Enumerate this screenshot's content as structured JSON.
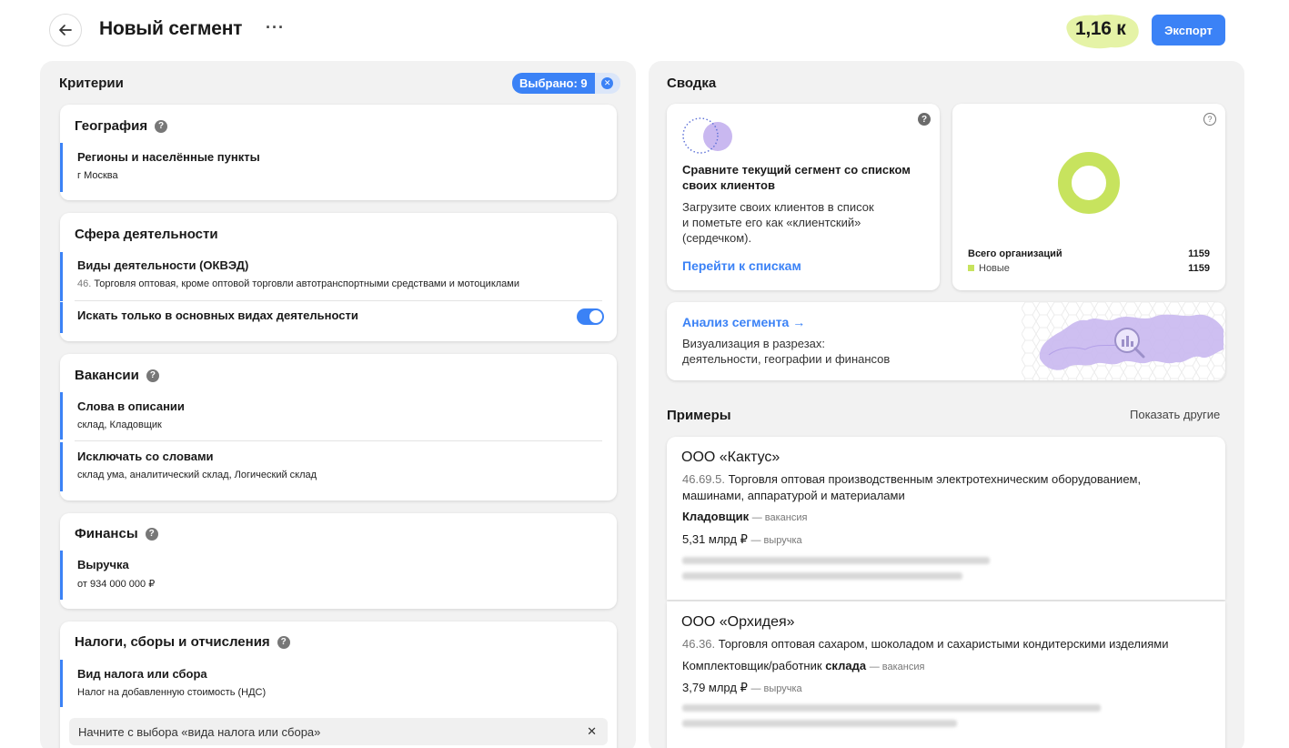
{
  "header": {
    "title": "Новый сегмент",
    "more": "···",
    "count": "1,16 к",
    "export_label": "Экспорт"
  },
  "criteria": {
    "title": "Критерии",
    "selected": "Выбрано: 9",
    "geography": {
      "title": "География",
      "regions_label": "Регионы и населённые пункты",
      "regions_value": "г Москва"
    },
    "activity": {
      "title": "Сфера деятельности",
      "okved_label": "Виды деятельности (ОКВЭД)",
      "okved_code": "46.",
      "okved_value": "Торговля оптовая, кроме оптовой торговли автотранспортными средствами и мотоциклами",
      "main_only_label": "Искать только в основных видах деятельности",
      "main_only_on": true
    },
    "vacancies": {
      "title": "Вакансии",
      "words_label": "Слова в описании",
      "words_value": "склад, Кладовщик",
      "exclude_label": "Исключать со словами",
      "exclude_value": "склад ума, аналитический склад, Логический склад"
    },
    "finance": {
      "title": "Финансы",
      "revenue_label": "Выручка",
      "revenue_value": "от 934 000 000 ₽"
    },
    "taxes": {
      "title": "Налоги, сборы и отчисления",
      "tax_label": "Вид налога или сбора",
      "tax_value": "Налог на добавленную стоимость (НДС)",
      "input_placeholder": "Начните с выбора «вида налога или сбора»"
    }
  },
  "summary": {
    "title": "Сводка",
    "compare": {
      "title": "Сравните текущий сегмент со списком своих клиентов",
      "description_lines": [
        "Загрузите своих клиентов в список",
        "и пометьте его как «клиентский»",
        "(сердечком)."
      ],
      "link": "Перейти к спискам"
    },
    "stats": {
      "total_label": "Всего организаций",
      "total_value": "1159",
      "new_label": "Новые",
      "new_value": "1159",
      "new_color": "#c7e35e"
    },
    "analysis": {
      "link": "Анализ сегмента →",
      "description_lines": [
        "Визуализация в разрезах:",
        "деятельности, географии и финансов"
      ]
    }
  },
  "examples": {
    "title": "Примеры",
    "show_more": "Показать другие",
    "items": [
      {
        "name": "ООО «Кактус»",
        "code": "46.69.5.",
        "activity": "Торговля оптовая производственным электротехническим оборудованием, машинами, аппаратурой и материалами",
        "vacancy_pre": "",
        "vacancy_bold": "Кладовщик",
        "vacancy_tag": "— вакансия",
        "revenue": "5,31 млрд ₽",
        "revenue_tag": "— выручка"
      },
      {
        "name": "ООО «Орхидея»",
        "code": "46.36.",
        "activity": "Торговля оптовая сахаром, шоколадом и сахаристыми кондитерскими изделиями",
        "vacancy_pre": "Комплектовщик/работник ",
        "vacancy_bold": "склада",
        "vacancy_tag": "— вакансия",
        "revenue": "3,79 млрд ₽",
        "revenue_tag": "— выручка"
      }
    ]
  },
  "colors": {
    "accent": "#3b82f6",
    "lime": "#c7e35e",
    "purple": "#c9b8f0"
  }
}
